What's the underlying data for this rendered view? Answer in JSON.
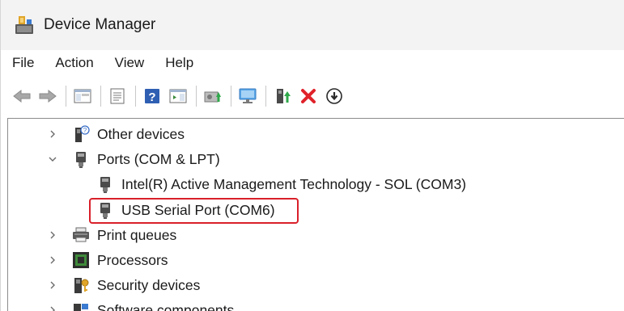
{
  "window": {
    "title": "Device Manager"
  },
  "menu": {
    "items": [
      "File",
      "Action",
      "View",
      "Help"
    ]
  },
  "toolbar": {
    "buttons": [
      "back-arrow-icon",
      "forward-arrow-icon",
      "show-hide-console-tree-icon",
      "properties-icon",
      "help-icon",
      "action-pane-icon",
      "update-driver-icon",
      "scan-hardware-icon",
      "enable-device-icon",
      "uninstall-device-icon",
      "install-driver-icon"
    ]
  },
  "tree": {
    "nodes": [
      {
        "label": "Other devices",
        "expanded": false,
        "icon": "unknown-device-icon"
      },
      {
        "label": "Ports (COM & LPT)",
        "expanded": true,
        "icon": "port-connector-icon",
        "children": [
          {
            "label": "Intel(R) Active Management Technology - SOL (COM3)",
            "icon": "port-connector-icon"
          },
          {
            "label": "USB Serial Port (COM6)",
            "icon": "port-connector-icon",
            "highlighted": true
          }
        ]
      },
      {
        "label": "Print queues",
        "expanded": false,
        "icon": "printer-icon"
      },
      {
        "label": "Processors",
        "expanded": false,
        "icon": "processor-chip-icon"
      },
      {
        "label": "Security devices",
        "expanded": false,
        "icon": "security-key-icon"
      },
      {
        "label": "Software components",
        "expanded": false,
        "icon": "software-component-icon"
      }
    ]
  },
  "colors": {
    "highlight": "#d9202a",
    "titlebar_bg": "#f3f3f3",
    "accent_blue": "#1f6fc9"
  }
}
